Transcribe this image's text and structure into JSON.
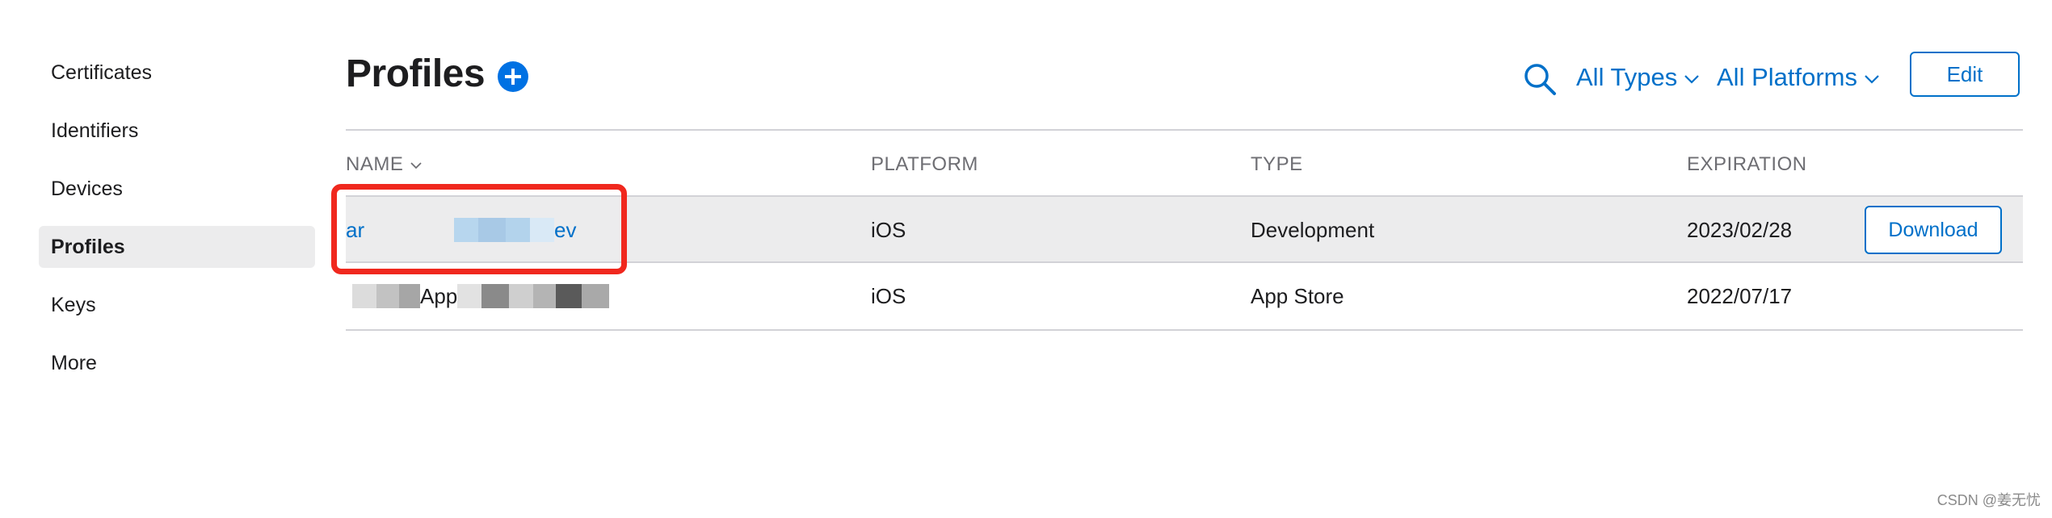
{
  "sidebar": {
    "items": [
      {
        "label": "Certificates"
      },
      {
        "label": "Identifiers"
      },
      {
        "label": "Devices"
      },
      {
        "label": "Profiles",
        "active": true
      },
      {
        "label": "Keys"
      },
      {
        "label": "More"
      }
    ]
  },
  "header": {
    "title": "Profiles",
    "add_icon": "plus-circle-icon",
    "search_icon": "search-icon",
    "types_filter": "All Types",
    "platforms_filter": "All Platforms",
    "edit_label": "Edit"
  },
  "table": {
    "columns": [
      "NAME",
      "PLATFORM",
      "TYPE",
      "EXPIRATION"
    ],
    "sort_icon": "chevron-down-icon",
    "rows": [
      {
        "name_start": "ar",
        "name_end": "ev",
        "platform": "iOS",
        "type": "Development",
        "expiration": "2023/02/28",
        "action": "Download",
        "selected": true
      },
      {
        "name_visible": "App",
        "platform": "iOS",
        "type": "App Store",
        "expiration": "2022/07/17"
      }
    ]
  },
  "colors": {
    "accent": "#0070c9",
    "highlight": "#f0281e",
    "row_selected": "#ececed",
    "divider": "#d2d2d7"
  },
  "watermark": "CSDN @姜无忧"
}
